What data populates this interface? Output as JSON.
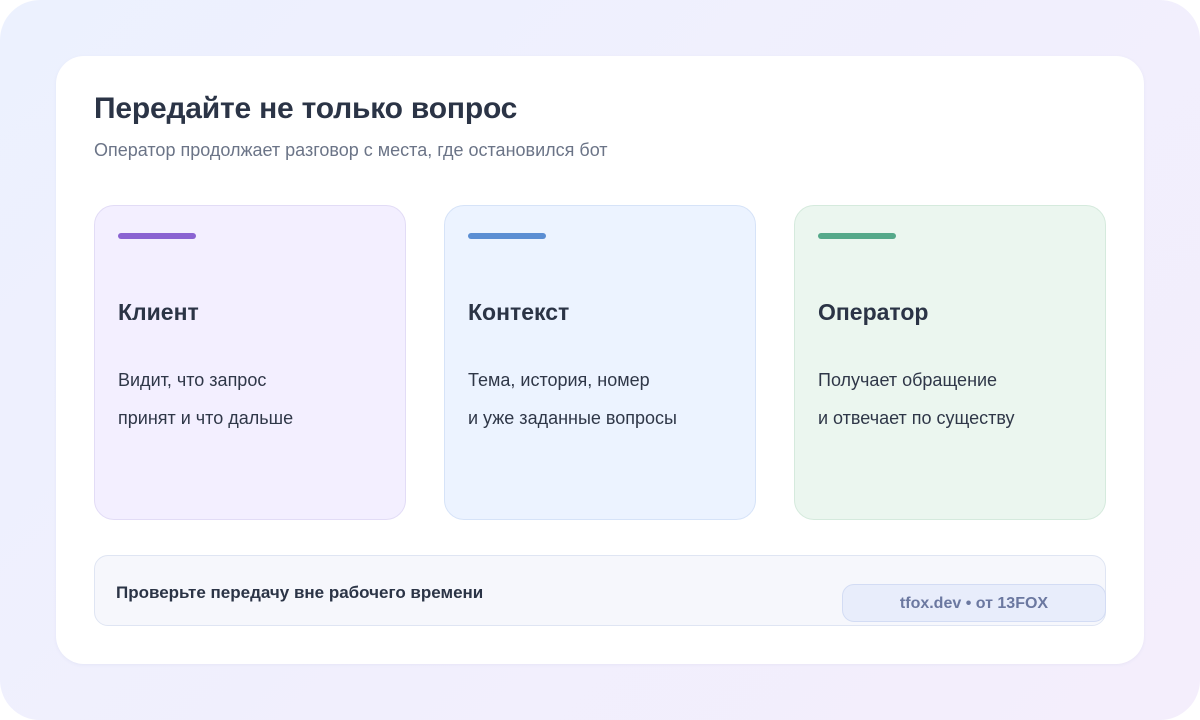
{
  "header": {
    "title": "Передайте не только вопрос",
    "subtitle": "Оператор продолжает разговор с места, где остановился бот"
  },
  "columns": [
    {
      "heading": "Клиент",
      "line1": "Видит, что запрос",
      "line2": "принят и что дальше",
      "accent": "#8a63d2"
    },
    {
      "heading": "Контекст",
      "line1": "Тема, история, номер",
      "line2": "и уже заданные вопросы",
      "accent": "#5b8ed3"
    },
    {
      "heading": "Оператор",
      "line1": "Получает обращение",
      "line2": "и отвечает по существу",
      "accent": "#55a98a"
    }
  ],
  "footer": {
    "text": "Проверьте передачу вне рабочего времени",
    "badge": "tfox.dev • от 13FOX"
  }
}
